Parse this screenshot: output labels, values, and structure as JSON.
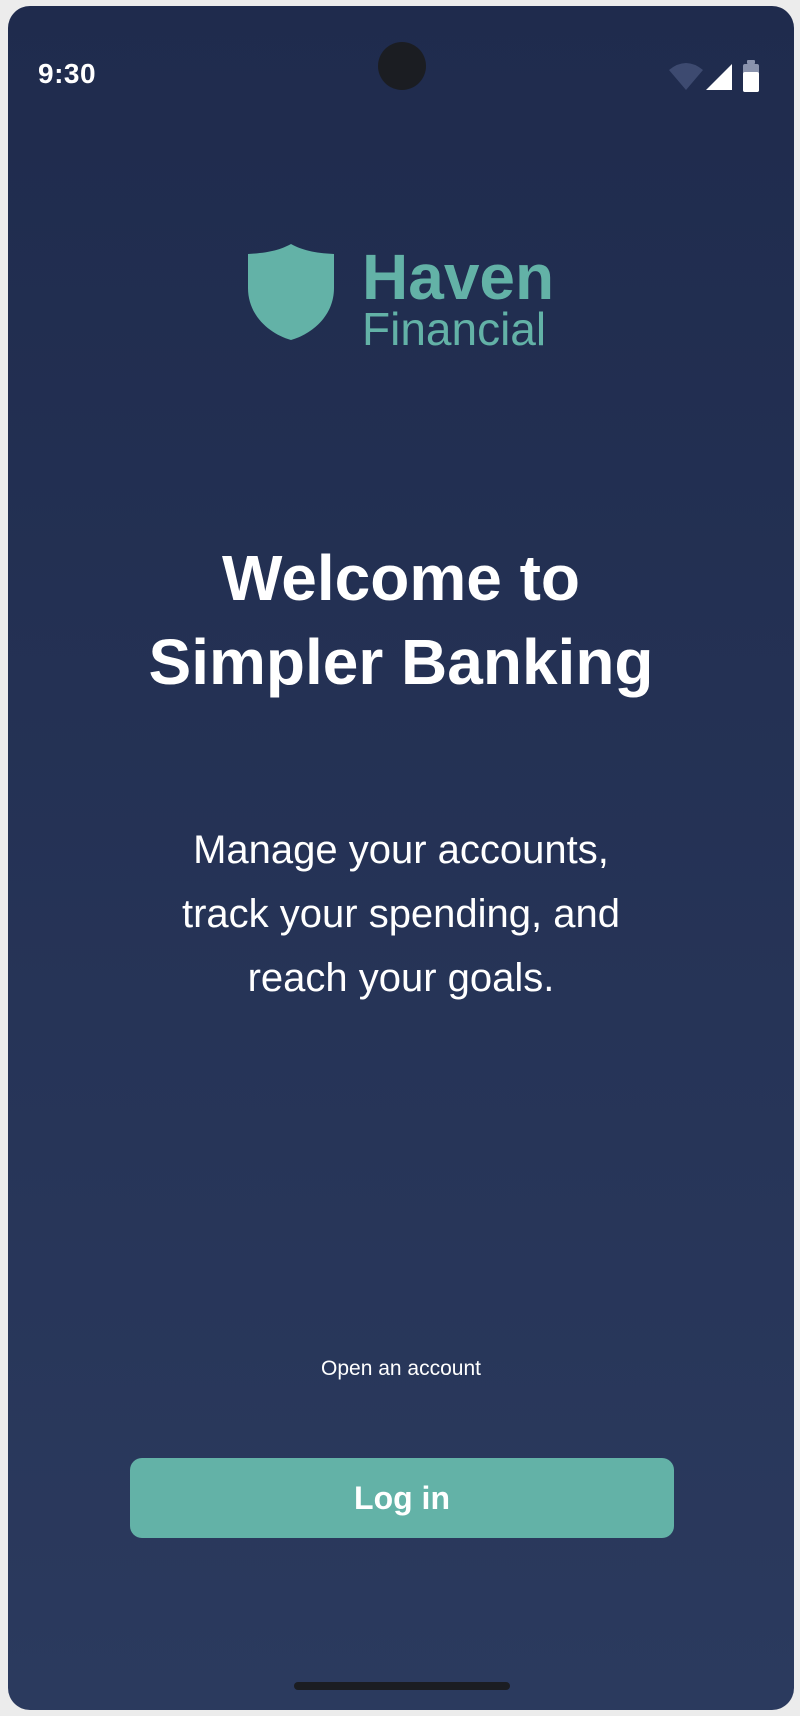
{
  "status_bar": {
    "time": "9:30",
    "icons": [
      "wifi-icon",
      "signal-icon",
      "battery-icon"
    ]
  },
  "brand": {
    "name_line1": "Haven",
    "name_line2": "Financial",
    "logo_icon": "shield-icon",
    "color": "#63b2a7"
  },
  "welcome": {
    "headline_line1": "Welcome to",
    "headline_line2": "Simpler Banking",
    "subtitle_line1": "Manage your accounts,",
    "subtitle_line2": "track your spending, and",
    "subtitle_line3": "reach your goals."
  },
  "actions": {
    "open_account_label": "Open an account",
    "login_label": "Log in"
  },
  "colors": {
    "background_top": "#1f2b4d",
    "background_bottom": "#2b3a5e",
    "accent": "#63b2a7",
    "text": "#ffffff"
  }
}
